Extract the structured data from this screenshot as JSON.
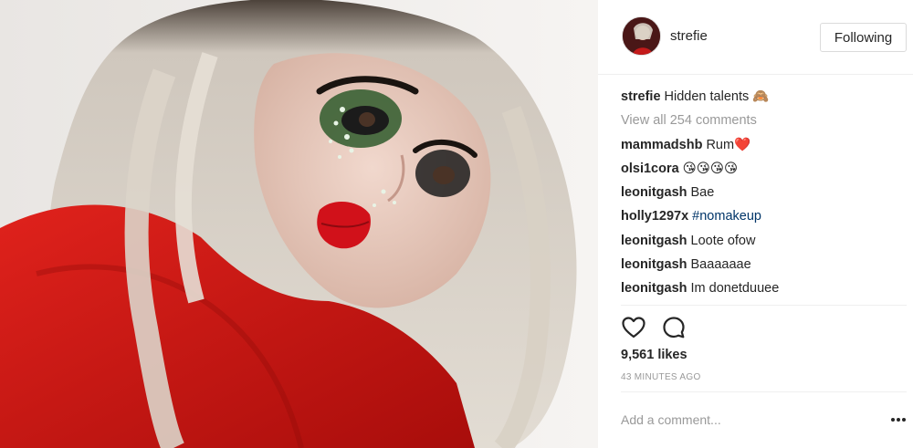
{
  "post": {
    "username": "strefie",
    "follow_label": "Following",
    "caption_user": "strefie",
    "caption_text": "Hidden talents 🙈",
    "view_all": "View all 254 comments",
    "comments": [
      {
        "user": "mammadshb",
        "text": "Rum❤️"
      },
      {
        "user": "olsi1cora",
        "text": "😘😘😘😘"
      },
      {
        "user": "leonitgash",
        "text": "Bae"
      },
      {
        "user": "holly1297x",
        "text": "#nomakeup"
      },
      {
        "user": "leonitgash",
        "text": "Loote ofow"
      },
      {
        "user": "leonitgash",
        "text": "Baaaaaae"
      },
      {
        "user": "leonitgash",
        "text": "Im donetduuee"
      }
    ],
    "likes": "9,561 likes",
    "time_ago": "43 MINUTES AGO",
    "add_comment_placeholder": "Add a comment..."
  },
  "icons": {
    "like": "heart-icon",
    "comment": "comment-icon",
    "more": "more-options-icon"
  },
  "colors": {
    "text": "#262626",
    "muted": "#999999",
    "hashtag": "#003569",
    "border": "#dbdbdb"
  }
}
